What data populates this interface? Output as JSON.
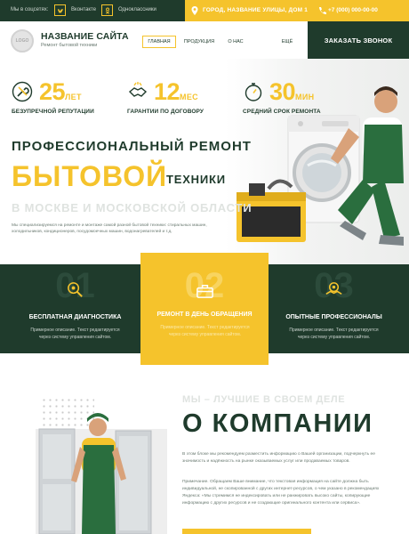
{
  "topbar": {
    "social_label": "Мы в соцсетях:",
    "links": [
      {
        "icon": "vk-icon",
        "label": "Вконтакте"
      },
      {
        "icon": "odnoklassniki-icon",
        "label": "Одноклассники"
      }
    ],
    "address": "ГОРОД, НАЗВАНИЕ УЛИЦЫ, ДОМ 1",
    "phone": "+7 (000) 000-00-00"
  },
  "header": {
    "logo_text": "LOGO",
    "site_name": "НАЗВАНИЕ САЙТА",
    "site_sub": "Ремонт бытовой техники",
    "nav": [
      "ГЛАВНАЯ",
      "ПРОДУКЦИЯ",
      "О НАС",
      "ЕЩЁ"
    ],
    "call_button": "ЗАКАЗАТЬ ЗВОНОК"
  },
  "hero": {
    "stats": [
      {
        "icon": "wrench-icon",
        "value": "25",
        "unit": "ЛЕТ",
        "caption": "БЕЗУПРЕЧНОЙ РЕПУТАЦИИ"
      },
      {
        "icon": "handshake-icon",
        "value": "12",
        "unit": "МЕС",
        "caption": "ГАРАНТИИ ПО ДОГОВОРУ"
      },
      {
        "icon": "stopwatch-icon",
        "value": "30",
        "unit": "МИН",
        "caption": "СРЕДНИЙ СРОК РЕМОНТА"
      }
    ],
    "line1": "ПРОФЕССИОНАЛЬНЫЙ РЕМОНТ",
    "line2_big": "БЫТОВОЙ",
    "line2_small": "ТЕХНИКИ",
    "line3": "В МОСКВЕ И МОСКОВСКОЙ ОБЛАСТИ",
    "description": "Мы специализируемся на ремонте и монтаже самой разной бытовой техники: стиральных машин, холодильников, кондиционеров, посудомоечных машин, водонагревателей и т.д."
  },
  "features": [
    {
      "num": "01",
      "icon": "magnifier-gear-icon",
      "title": "БЕСПЛАТНАЯ ДИАГНОСТИКА",
      "text": "Примерное описание. Текст редактируется через систему управления сайтом."
    },
    {
      "num": "02",
      "icon": "toolbox-icon",
      "title": "РЕМОНТ В ДЕНЬ ОБРАЩЕНИЯ",
      "text": "Примерное описание. Текст редактируется через систему управления сайтом."
    },
    {
      "num": "03",
      "icon": "handshake-gear-icon",
      "title": "ОПЫТНЫЕ ПРОФЕССИОНАЛЫ",
      "text": "Примерное описание. Текст редактируется через систему управления сайтом."
    }
  ],
  "about": {
    "subtitle": "МЫ – ЛУЧШИЕ В СВОЕМ ДЕЛЕ",
    "title": "О КОМПАНИИ",
    "p1": "В этом блоке мы рекомендуем разместить информацию о Вашей организации, подчеркнуть ее значимость и надёжность на рынке оказываемых услуг или продаваемых товаров.",
    "p2": "Примечание. Обращаем Ваше внимание, что текстовая информация на сайте должна быть индивидуальной, не скопированной с других интернет-ресурсов, о чем указано в рекомендациях Яндекса: «Мы стремимся не индексировать или не ранжировать высоко сайты, копирующие информацию с других ресурсов и не создающие оригинального контента или сервиса»."
  },
  "colors": {
    "primary_green": "#1f3b2c",
    "accent_yellow": "#f5c32c"
  }
}
